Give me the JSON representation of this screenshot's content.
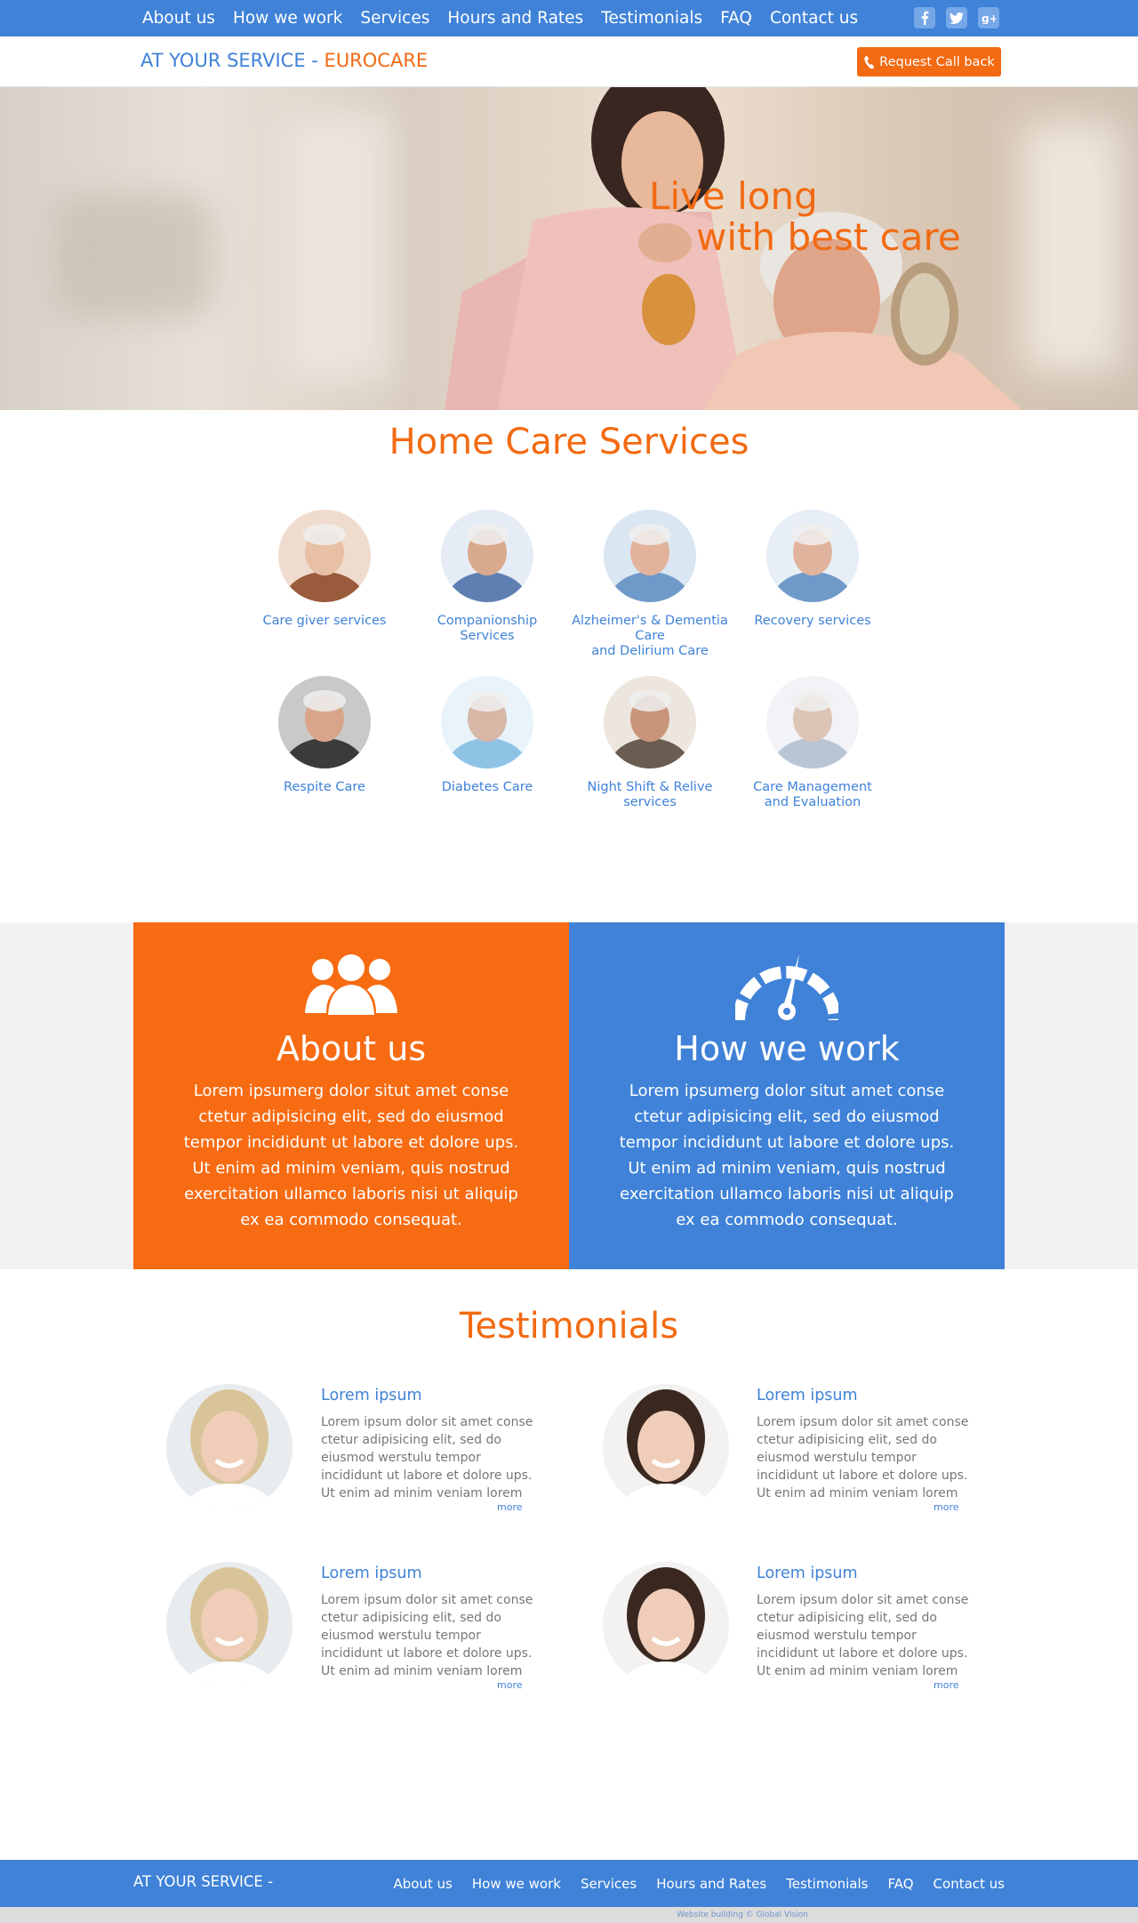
{
  "nav": {
    "links": [
      "About us",
      "How we work",
      "Services",
      "Hours and Rates",
      "Testimonials",
      "FAQ",
      "Contact us"
    ],
    "social": [
      "facebook-icon",
      "twitter-icon",
      "google-plus-icon"
    ]
  },
  "brand": {
    "prefix": "AT YOUR SERVICE - ",
    "accent": "EUROCARE"
  },
  "callback": {
    "label": "Request Call back",
    "icon": "phone-icon"
  },
  "hero": {
    "line1": "Live long",
    "line2": "with best care"
  },
  "services": {
    "title": "Home Care Services",
    "items": [
      {
        "label": "Care giver services"
      },
      {
        "label": "Companionship\nServices"
      },
      {
        "label": "Alzheimer's & Dementia\nCare\nand Delirium Care"
      },
      {
        "label": "Recovery services"
      },
      {
        "label": "Respite Care"
      },
      {
        "label": "Diabetes Care"
      },
      {
        "label": "Night Shift & Relive\nservices"
      },
      {
        "label": "Care Management\nand Evaluation"
      }
    ]
  },
  "features": {
    "about": {
      "title": "About us",
      "icon": "users-icon",
      "text": "Lorem ipsumerg dolor situt amet conse ctetur adipisicing elit, sed do eiusmod tempor incididunt ut labore et dolore ups. Ut enim ad minim veniam, quis nostrud exercitation ullamco laboris nisi ut aliquip ex ea commodo consequat."
    },
    "how": {
      "title": "How we work",
      "icon": "speedometer-icon",
      "text": "Lorem ipsumerg dolor situt amet conse ctetur adipisicing elit, sed do eiusmod tempor incididunt ut labore et dolore ups. Ut enim ad minim veniam, quis nostrud exercitation ullamco laboris nisi ut aliquip ex ea commodo consequat."
    }
  },
  "testimonials": {
    "title": "Testimonials",
    "items": [
      {
        "name": "Lorem ipsum",
        "text": "Lorem ipsum dolor sit amet conse ctetur adipisicing elit, sed do eiusmod werstulu tempor incididunt ut labore et dolore ups. Ut enim ad minim veniam lorem",
        "more": "more"
      },
      {
        "name": "Lorem ipsum",
        "text": "Lorem ipsum dolor sit amet conse ctetur adipisicing elit, sed do eiusmod werstulu tempor incididunt ut labore et dolore ups. Ut enim ad minim veniam lorem",
        "more": "more"
      },
      {
        "name": "Lorem ipsum",
        "text": "Lorem ipsum dolor sit amet conse ctetur adipisicing elit, sed do eiusmod werstulu tempor incididunt ut labore et dolore ups. Ut enim ad minim veniam lorem",
        "more": "more"
      },
      {
        "name": "Lorem ipsum",
        "text": "Lorem ipsum dolor sit amet conse ctetur adipisicing elit, sed do eiusmod werstulu tempor incididunt ut labore et dolore ups. Ut enim ad minim veniam lorem",
        "more": "more"
      }
    ]
  },
  "footer": {
    "brand": "AT YOUR SERVICE -",
    "links": [
      "About us",
      "How we work",
      "Services",
      "Hours and Rates",
      "Testimonials",
      "FAQ",
      "Contact us"
    ],
    "credit": "Website building © Global Vision"
  },
  "colors": {
    "brand_blue": "#3f82d8",
    "brand_orange": "#f26a12",
    "band_gray": "#f2f2f2"
  }
}
